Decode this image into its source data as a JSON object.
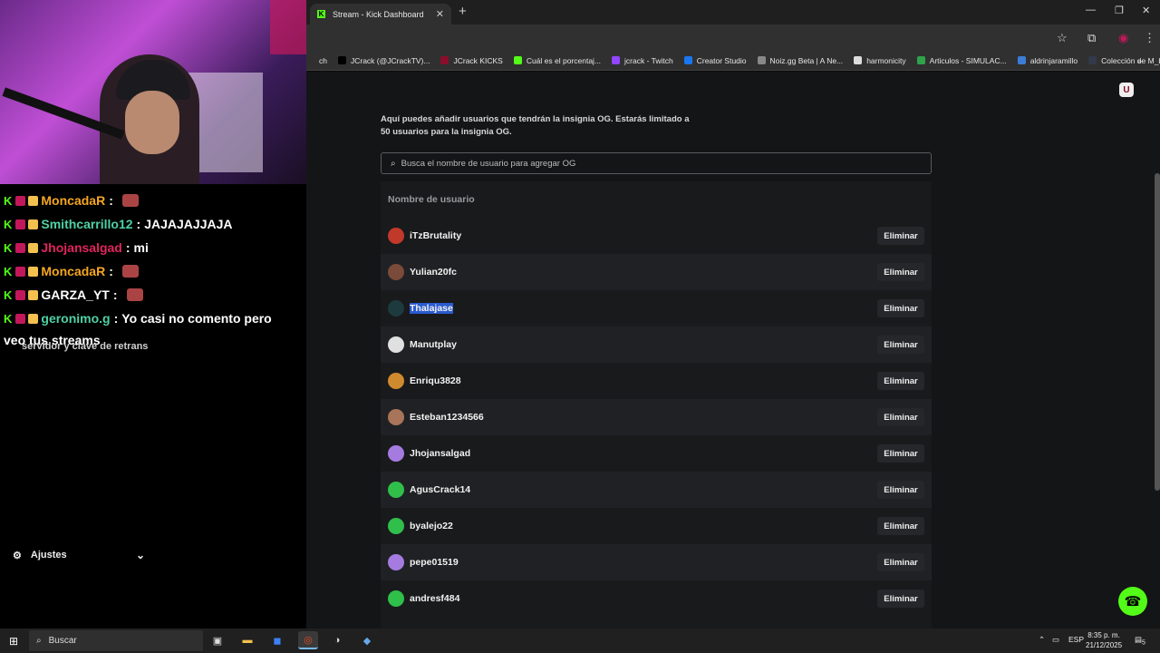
{
  "browser": {
    "tab_title": "Stream - Kick Dashboard",
    "tab_close": "✕",
    "new_tab": "+",
    "window_controls": [
      "—",
      "❐",
      "✕"
    ],
    "bookmarks": [
      {
        "label": "ch",
        "color": "#303030"
      },
      {
        "label": "JCrack (@JCrackTV)...",
        "color": "#000000"
      },
      {
        "label": "JCrack KICKS",
        "color": "#8b0d2b"
      },
      {
        "label": "Cuál es el porcentaj...",
        "color": "#53fc18"
      },
      {
        "label": "jcrack - Twitch",
        "color": "#9146ff"
      },
      {
        "label": "Creator Studio",
        "color": "#1877f2"
      },
      {
        "label": "Noiz.gg Beta | A Ne...",
        "color": "#888888"
      },
      {
        "label": "harmonicity",
        "color": "#dddddd"
      },
      {
        "label": "Articulos - SIMULAC...",
        "color": "#2fa34a"
      },
      {
        "label": "aldrinjaramillo",
        "color": "#3b7dd8"
      },
      {
        "label": "Colección de M_blei...",
        "color": "#333a4a"
      }
    ],
    "bookmarks_more": "»"
  },
  "chat": {
    "lines": [
      {
        "user": "MoncadaR",
        "sep": ":",
        "msg": "",
        "user_color": "#f5a623",
        "emote": true
      },
      {
        "user": "Smithcarrillo12",
        "sep": ":",
        "msg": "JAJAJAJJAJA",
        "user_color": "#4fd1a5",
        "emote": false
      },
      {
        "user": "Jhojansalgad",
        "sep": ":",
        "msg": "mi",
        "user_color": "#e0245e",
        "emote": false
      },
      {
        "user": "MoncadaR",
        "sep": ":",
        "msg": "",
        "user_color": "#f5a623",
        "emote": true
      },
      {
        "user": "GARZA_YT",
        "sep": ":",
        "msg": "",
        "user_color": "#ffffff",
        "emote": true
      },
      {
        "user": "geronimo.g",
        "sep": ":",
        "msg": "Yo casi no comento pero",
        "user_color": "#4fd1a5",
        "emote": false
      }
    ],
    "continuation": "veo tus streams",
    "ghost_text": "servidor y clave de retrans",
    "settings_label": "Ajustes"
  },
  "page": {
    "intro_text": "Aquí puedes añadir usuarios que tendrán la insignia OG. Estarás limitado a 50 usuarios para la insignia OG.",
    "search_placeholder": "Busca el nombre de usuario para agregar OG",
    "column_header": "Nombre de usuario",
    "delete_label": "Eliminar",
    "users": [
      {
        "name": "iTzBrutality",
        "avatar_color": "#c0392b",
        "selected": false
      },
      {
        "name": "Yulian20fc",
        "avatar_color": "#7a4a3a",
        "selected": false
      },
      {
        "name": "Thalajase",
        "avatar_color": "#1d3a3f",
        "selected": true
      },
      {
        "name": "Manutplay",
        "avatar_color": "#e0e0e0",
        "selected": false
      },
      {
        "name": "Enriqu3828",
        "avatar_color": "#d08a2e",
        "selected": false
      },
      {
        "name": "Esteban1234566",
        "avatar_color": "#a8745a",
        "selected": false
      },
      {
        "name": "Jhojansalgad",
        "avatar_color": "#a67be0",
        "selected": false
      },
      {
        "name": "AgusCrack14",
        "avatar_color": "#2fbf4a",
        "selected": false
      },
      {
        "name": "byalejo22",
        "avatar_color": "#2fbf4a",
        "selected": false
      },
      {
        "name": "pepe01519",
        "avatar_color": "#a67be0",
        "selected": false
      },
      {
        "name": "andresf484",
        "avatar_color": "#2fbf4a",
        "selected": false
      }
    ]
  },
  "taskbar": {
    "search_label": "Buscar",
    "language": "ESP",
    "time": "8:35 p. m.",
    "date": "21/12/2025",
    "notifications": "5"
  },
  "colors": {
    "kick_green": "#53fc18",
    "selection_blue": "#2b5bd0"
  }
}
